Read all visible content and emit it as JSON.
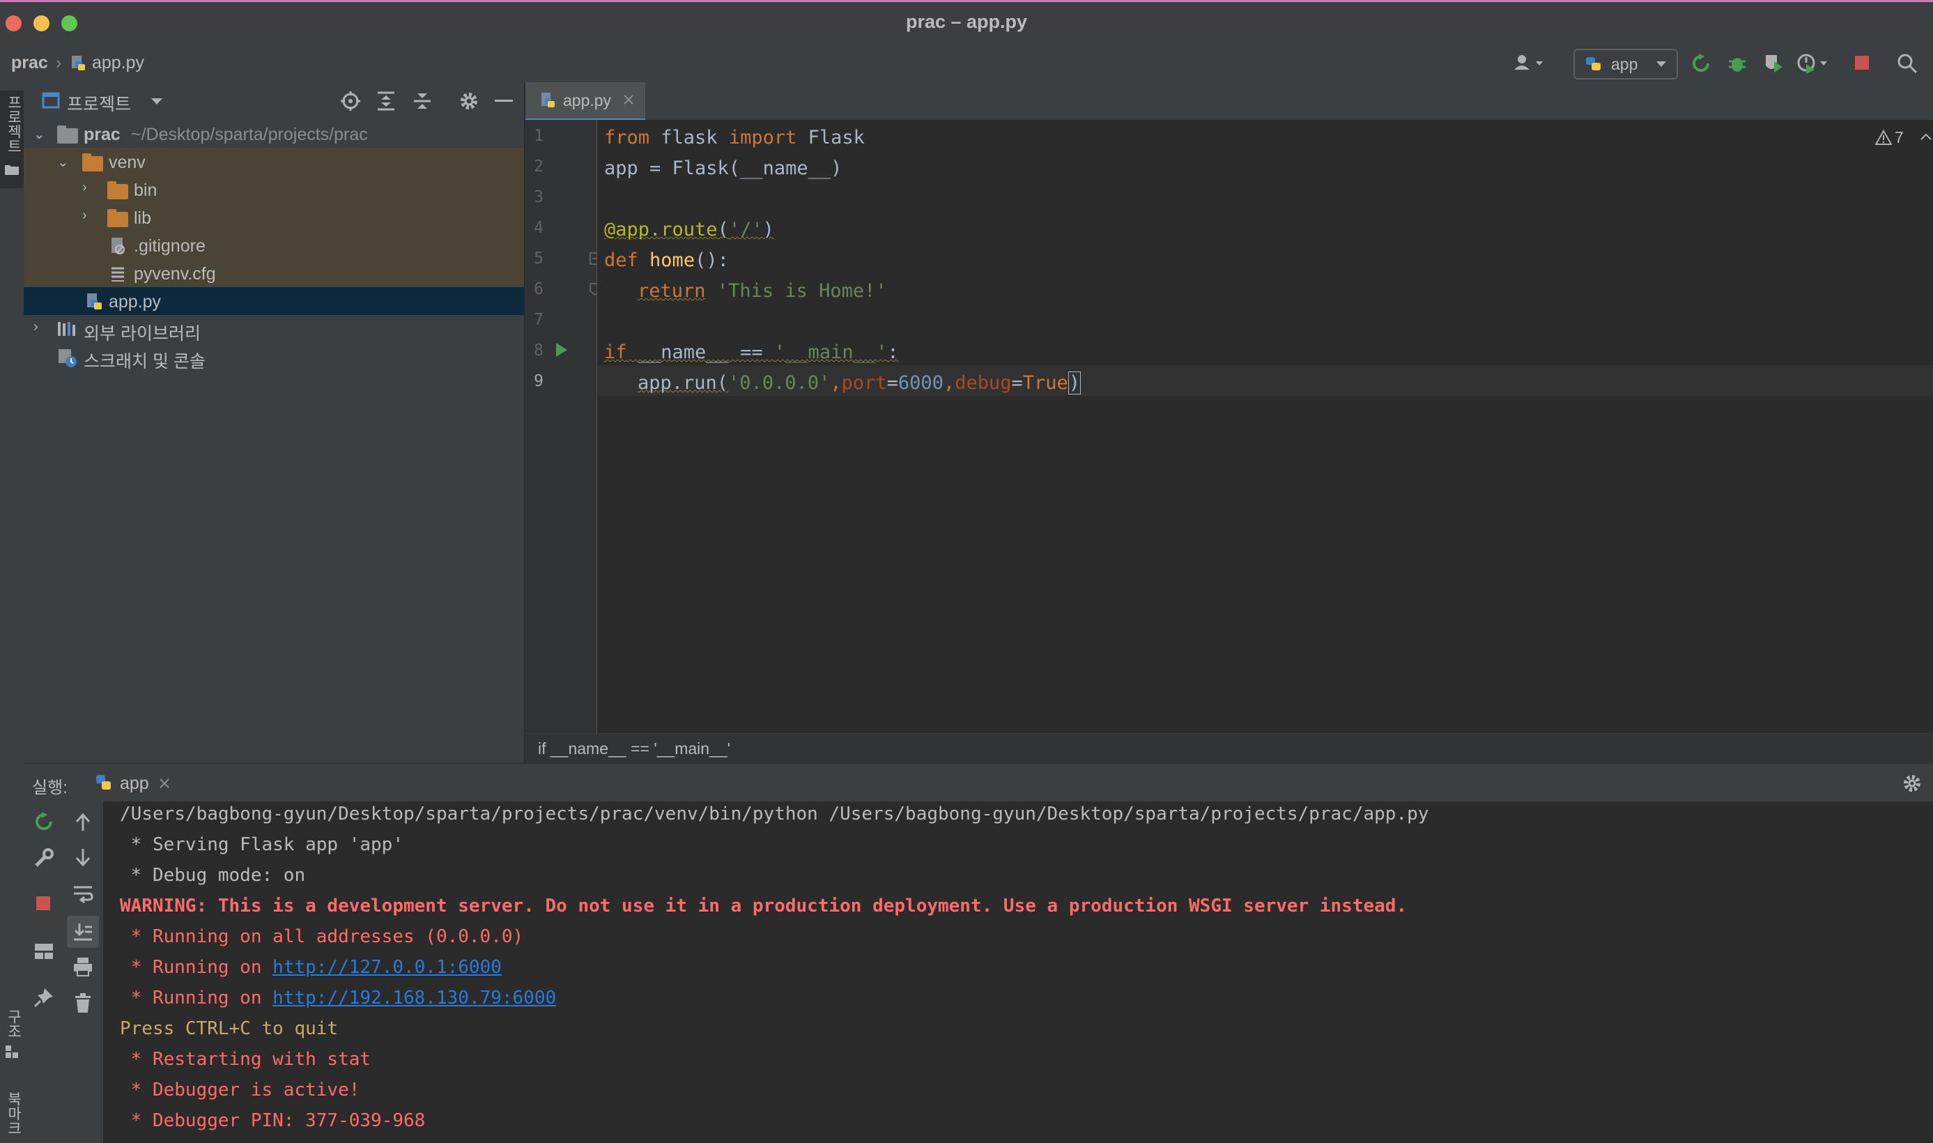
{
  "window": {
    "title": "prac – app.py"
  },
  "navbar": {
    "crumb_project": "prac",
    "crumb_file": "app.py",
    "run_config": "app"
  },
  "left_stripe": {
    "project_tab": "프로젝트",
    "structure_tab": "구조",
    "bookmarks_tab": "북마크"
  },
  "project_panel": {
    "title": "프로젝트",
    "tree": {
      "root_name": "prac",
      "root_path": "~/Desktop/sparta/projects/prac",
      "venv": "venv",
      "bin": "bin",
      "lib": "lib",
      "gitignore": ".gitignore",
      "pyvenv": "pyvenv.cfg",
      "app": "app.py",
      "ext_libs": "외부 라이브러리",
      "scratches": "스크래치 및 콘솔"
    }
  },
  "editor": {
    "tab_label": "app.py",
    "warnings_count": "7",
    "line_numbers": [
      "1",
      "2",
      "3",
      "4",
      "5",
      "6",
      "7",
      "8",
      "9"
    ],
    "lines": {
      "l1": {
        "k1": "from",
        "t1": " flask ",
        "k2": "import",
        "t2": " Flask"
      },
      "l2": {
        "t1": "app = Flask(__name__)"
      },
      "l4": {
        "d1": "@app.route",
        "t1": "(",
        "s1": "'/'",
        "t2": ")"
      },
      "l5": {
        "k1": "def",
        "t1": " ",
        "f1": "home",
        "t2": "():"
      },
      "l6": {
        "k1": "return",
        "t1": " ",
        "s1": "'This is Home!'"
      },
      "l8": {
        "k1": "if",
        "t1": " __name__ == ",
        "s1": "'__main__'",
        "t2": ":"
      },
      "l9": {
        "t1": "app.run(",
        "s1": "'0.0.0.0'",
        "t2": ",",
        "p1": "port",
        "t3": "=",
        "n1": "6000",
        "t4": ",",
        "p2": "debug",
        "t5": "=",
        "k1": "True",
        "t6": ")"
      }
    },
    "breadcrumb": "if __name__ == '__main__'"
  },
  "run_panel": {
    "label": "실행:",
    "tab": "app",
    "console": [
      {
        "cls": "c-norm",
        "text": "/Users/bagbong-gyun/Desktop/sparta/projects/prac/venv/bin/python /Users/bagbong-gyun/Desktop/sparta/projects/prac/app.py"
      },
      {
        "cls": "c-norm",
        "text": " * Serving Flask app 'app'"
      },
      {
        "cls": "c-norm",
        "text": " * Debug mode: on"
      },
      {
        "cls": "c-warn",
        "text": "WARNING: This is a development server. Do not use it in a production deployment. Use a production WSGI server instead."
      },
      {
        "cls": "c-red",
        "text": " * Running on all addresses (0.0.0.0)"
      },
      {
        "cls": "c-red",
        "prefix": " * Running on ",
        "link": "http://127.0.0.1:6000"
      },
      {
        "cls": "c-red",
        "prefix": " * Running on ",
        "link": "http://192.168.130.79:6000"
      },
      {
        "cls": "c-yel",
        "text": "Press CTRL+C to quit"
      },
      {
        "cls": "c-red",
        "text": " * Restarting with stat"
      },
      {
        "cls": "c-red",
        "text": " * Debugger is active!"
      },
      {
        "cls": "c-red",
        "text": " * Debugger PIN: 377-039-968"
      }
    ]
  },
  "colors": {
    "accent": "#4a88c7",
    "keyword": "#cc7832",
    "string": "#6a8759",
    "number": "#6897bb",
    "run_green": "#499c54",
    "stop_red": "#c75450"
  }
}
